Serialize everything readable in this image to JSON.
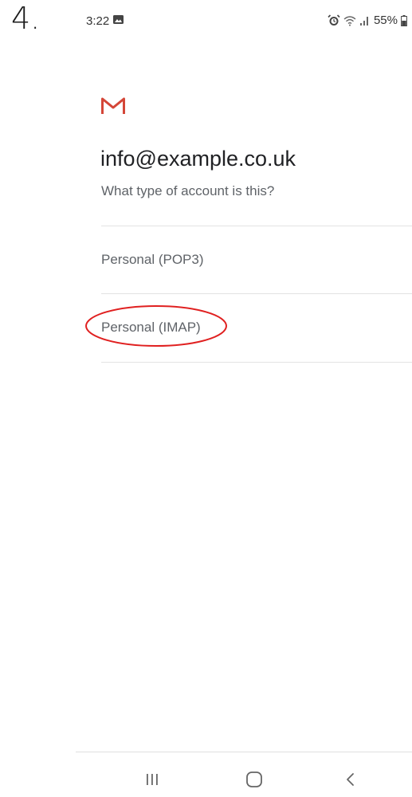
{
  "step": {
    "number": "4."
  },
  "status_bar": {
    "time": "3:22",
    "battery_percent": "55%",
    "icons": [
      "photo-icon",
      "alarm-icon",
      "wifi-icon",
      "signal-icon",
      "battery-icon"
    ]
  },
  "account": {
    "email": "info@example.co.uk",
    "question": "What type of account is this?"
  },
  "options": [
    {
      "label": "Personal (POP3)"
    },
    {
      "label": "Personal (IMAP)",
      "highlighted": true
    }
  ],
  "nav": {
    "icons": [
      "recents-icon",
      "home-icon",
      "back-icon"
    ]
  },
  "colors": {
    "gmail_red": "#d44638",
    "highlight_red": "#e02020",
    "text_primary": "#202124",
    "text_secondary": "#5f6368"
  }
}
